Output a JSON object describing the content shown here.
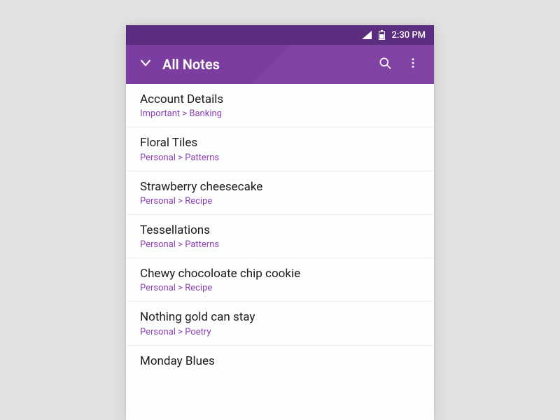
{
  "colors": {
    "statusbar": "#5b2e7f",
    "appbar": "#7c3da0",
    "accent": "#8b3fb2"
  },
  "statusbar": {
    "time": "2:30 PM"
  },
  "appbar": {
    "title": "All Notes"
  },
  "notes": [
    {
      "title": "Account Details",
      "path": "Important > Banking"
    },
    {
      "title": "Floral Tiles",
      "path": "Personal > Patterns"
    },
    {
      "title": "Strawberry cheesecake",
      "path": "Personal > Recipe"
    },
    {
      "title": "Tessellations",
      "path": "Personal > Patterns"
    },
    {
      "title": "Chewy chocoloate chip cookie",
      "path": "Personal > Recipe"
    },
    {
      "title": "Nothing gold can stay",
      "path": "Personal > Poetry"
    },
    {
      "title": "Monday Blues",
      "path": ""
    }
  ]
}
